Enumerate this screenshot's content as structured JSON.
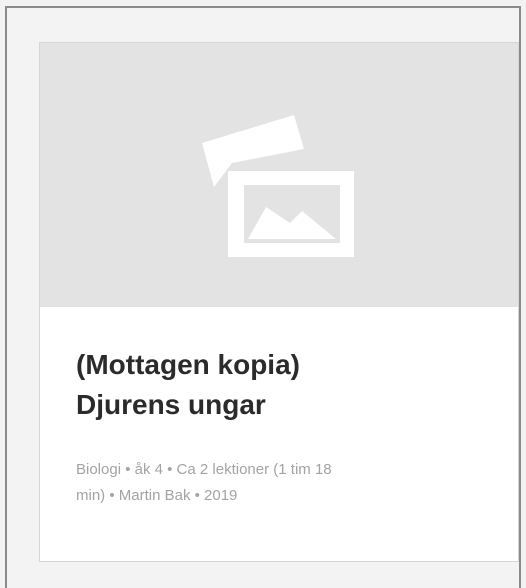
{
  "card": {
    "thumbnail_icon": "image-placeholder-icon",
    "title_line1": "(Mottagen kopia)",
    "title_line2": "Djurens ungar",
    "meta_line1": "Biologi • åk 4 • Ca 2 lektioner (1 tim 18",
    "meta_line2": "min) • Martin Bak • 2019"
  },
  "colors": {
    "page_background": "#f2f2f2",
    "frame_border": "#8a8a8a",
    "thumbnail_background": "#e3e3e3",
    "icon_color": "#ffffff",
    "title_color": "#2b2b2b",
    "meta_color": "#a3a3a3"
  }
}
